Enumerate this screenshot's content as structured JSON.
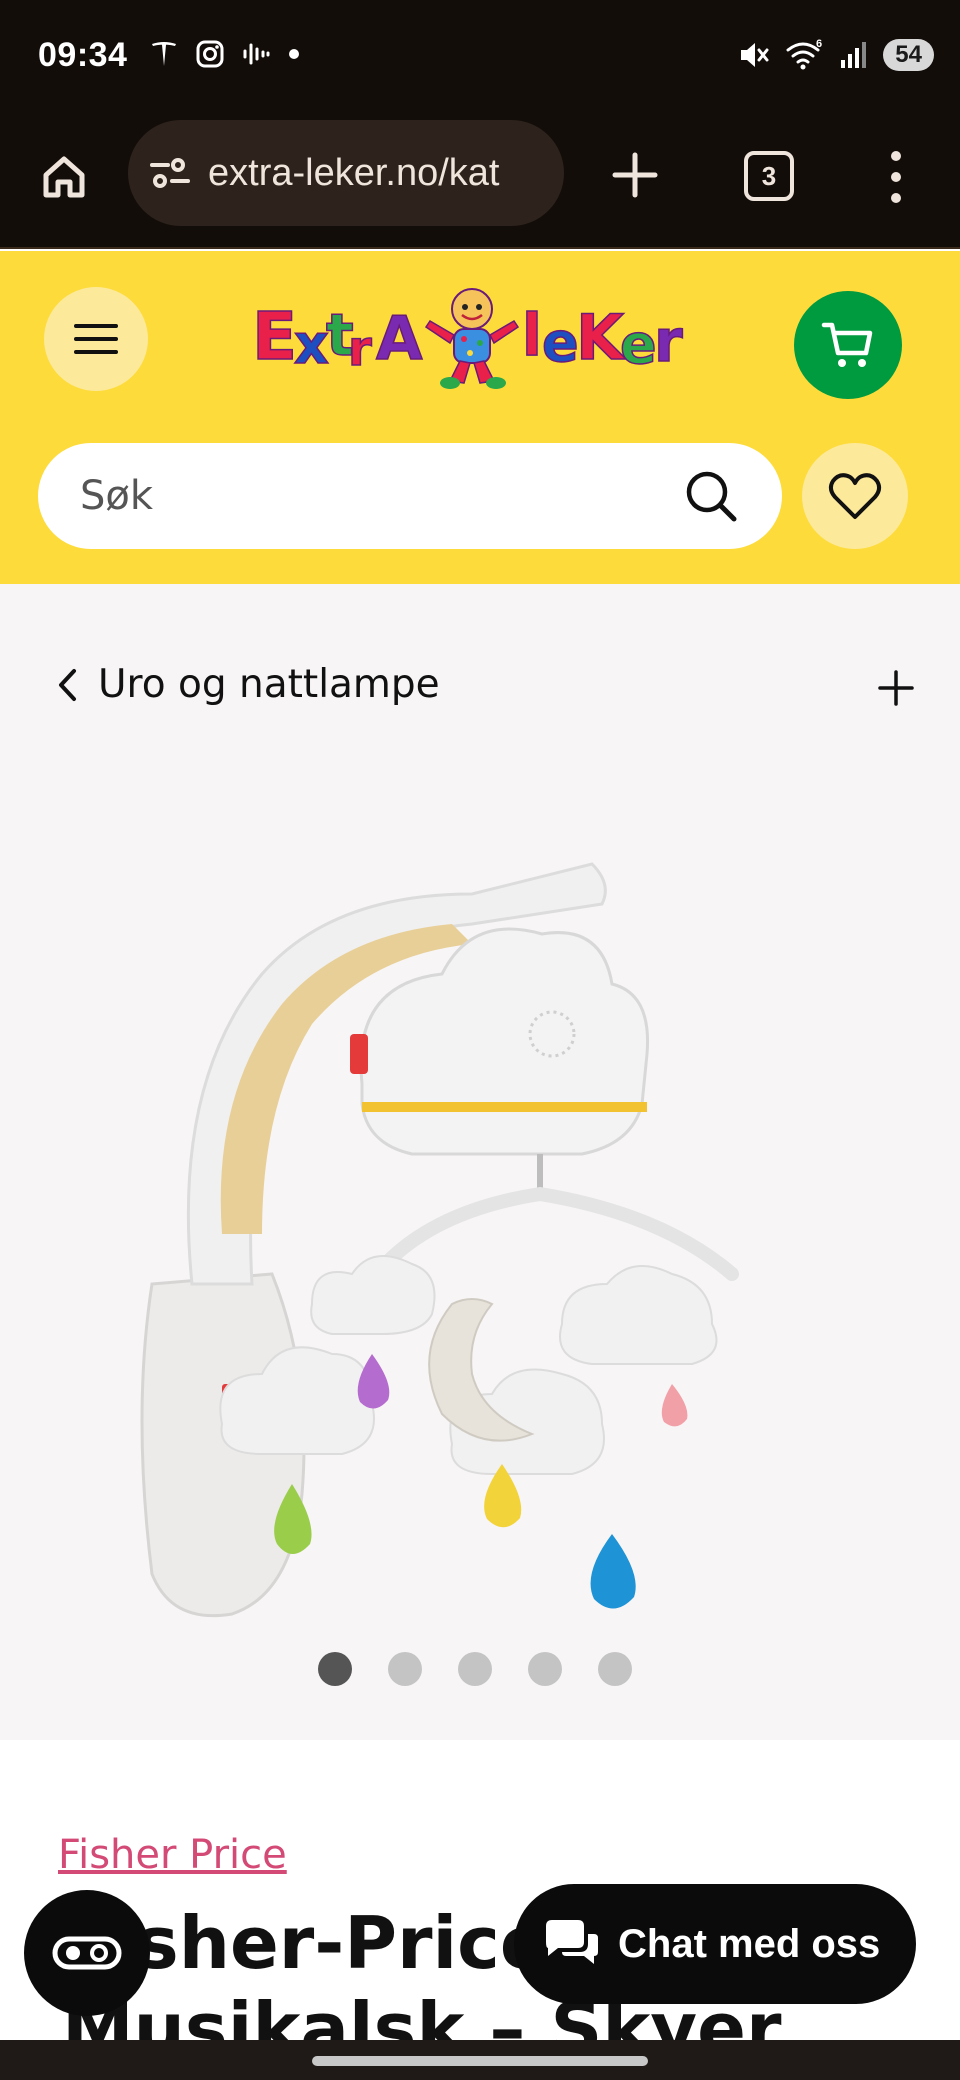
{
  "status_bar": {
    "time": "09:34",
    "battery": "54",
    "icons_left": [
      "tesla-icon",
      "instagram-icon",
      "soundwave-icon",
      "dot-icon"
    ],
    "icons_right": [
      "mute-icon",
      "wifi-icon",
      "signal-icon",
      "battery-icon"
    ]
  },
  "browser": {
    "url": "extra-leker.no/kat",
    "tab_count": "3"
  },
  "header": {
    "logo_text": "ExtraLeker",
    "search_placeholder": "Søk"
  },
  "breadcrumb": {
    "label": "Uro og nattlampe"
  },
  "gallery": {
    "slide_count": 5,
    "active_slide": 1
  },
  "product": {
    "brand": "Fisher Price",
    "title": "Fisher-Price Musikalsk – Skyer"
  },
  "chat": {
    "label": "Chat med oss"
  },
  "colors": {
    "header_yellow": "#fddb3b",
    "cart_green": "#009a3f",
    "brand_link_pink": "#d44a77"
  }
}
